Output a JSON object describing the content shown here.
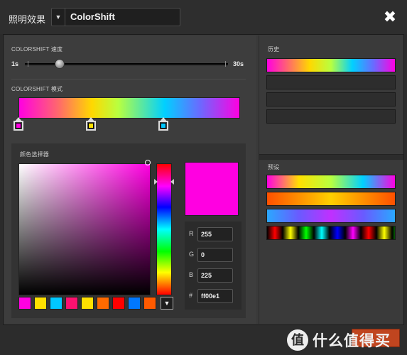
{
  "header": {
    "title": "照明效果",
    "mode_select_value": "ColorShift",
    "close_glyph": "✖"
  },
  "speed": {
    "label": "COLORSHIFT 速度",
    "min_label": "1s",
    "max_label": "30s",
    "value_fraction": 0.17
  },
  "pattern": {
    "label": "COLORSHIFT 模式",
    "gradient_colors": [
      "#ff00e1",
      "#ff6a6a",
      "#ffd800",
      "#b8ff40",
      "#00d0ff",
      "#6a6aff",
      "#ff00e1"
    ],
    "stops": [
      {
        "color": "#ff00e1"
      },
      {
        "color": "#ffe000"
      },
      {
        "color": "#00c8ff"
      }
    ]
  },
  "picker": {
    "label": "颜色选择器",
    "current_color": "#ff00e1",
    "r_label": "R",
    "g_label": "G",
    "b_label": "B",
    "hex_label": "#",
    "r_value": "255",
    "g_value": "0",
    "b_value": "225",
    "hex_value": "ff00e1",
    "swatches": [
      "#ff00e1",
      "#ffe000",
      "#00c8ff",
      "#ff1070",
      "#ffe000",
      "#ff6a00",
      "#ff0000",
      "#0078ff",
      "#ff5a00"
    ],
    "dropdown_glyph": "▼"
  },
  "history": {
    "label": "历史",
    "slots": [
      "gradient",
      "empty",
      "empty",
      "empty"
    ]
  },
  "presets": {
    "label": "预设"
  },
  "watermark": {
    "icon": "值",
    "text": "什么值得买"
  }
}
